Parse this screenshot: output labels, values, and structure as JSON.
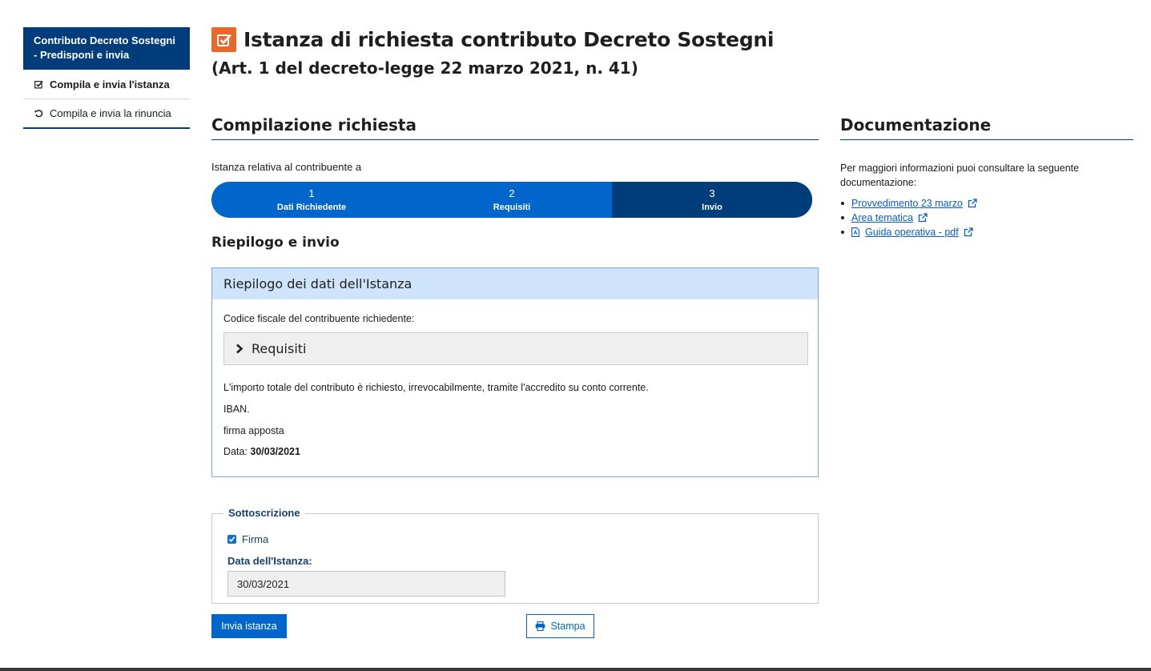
{
  "sidebar": {
    "header": "Contributo Decreto Sostegni - Predisponi e invia",
    "items": [
      {
        "label": "Compila e invia l'istanza",
        "icon": "check-square-icon"
      },
      {
        "label": "Compila e invia la rinuncia",
        "icon": "undo-icon"
      }
    ]
  },
  "header": {
    "title": "Istanza di richiesta contributo Decreto Sostegni",
    "subtitle": "(Art. 1 del decreto-legge 22 marzo 2021, n. 41)",
    "icon": "check-square-icon",
    "icon_color": "#e8672a"
  },
  "main": {
    "section_title": "Compilazione richiesta",
    "intro": "Istanza relativa al contribuente a",
    "stepper": [
      {
        "num": "1",
        "label": "Dati Richiedente"
      },
      {
        "num": "2",
        "label": "Requisiti"
      },
      {
        "num": "3",
        "label": "Invio"
      }
    ],
    "stepper_colors": {
      "done": "#0066cc",
      "current": "#003d7a"
    },
    "riepilogo_title": "Riepilogo e invio",
    "summary": {
      "title": "Riepilogo dei dati dell'Istanza",
      "cf_label": "Codice fiscale del contribuente richiedente:",
      "accordion_label": "Requisiti",
      "importo_text": "L'importo totale del contributo è richiesto, irrevocabilmente, tramite l'accredito su conto corrente.",
      "iban_label": "IBAN.",
      "firma_text": "firma apposta",
      "data_label": "Data:",
      "data_value": "30/03/2021"
    },
    "sottoscrizione": {
      "legend": "Sottoscrizione",
      "firma_label": "Firma",
      "data_label": "Data dell'Istanza:",
      "data_value": "30/03/2021"
    },
    "buttons": {
      "invia": "Invia istanza",
      "stampa": "Stampa"
    }
  },
  "documentazione": {
    "title": "Documentazione",
    "intro": "Per maggiori informazioni puoi consultare la seguente documentazione:",
    "links": [
      {
        "label": "Provvedimento 23 marzo"
      },
      {
        "label": "Area tematica"
      },
      {
        "label": "Guida operativa - pdf"
      }
    ]
  }
}
